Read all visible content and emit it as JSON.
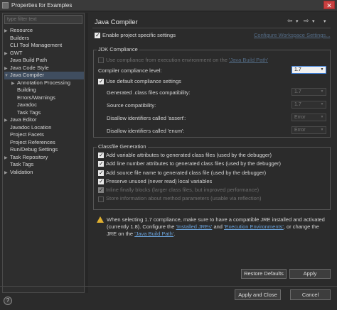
{
  "window": {
    "title": "Properties for Examples",
    "close_glyph": "✕"
  },
  "filter": {
    "placeholder": "type filter text"
  },
  "tree": [
    {
      "label": "Resource",
      "arrow": "▶",
      "indent": 0
    },
    {
      "label": "Builders",
      "arrow": "",
      "indent": 0
    },
    {
      "label": "CLI Tool Management",
      "arrow": "",
      "indent": 0
    },
    {
      "label": "GWT",
      "arrow": "▶",
      "indent": 0
    },
    {
      "label": "Java Build Path",
      "arrow": "",
      "indent": 0
    },
    {
      "label": "Java Code Style",
      "arrow": "▶",
      "indent": 0
    },
    {
      "label": "Java Compiler",
      "arrow": "▼",
      "indent": 0,
      "selected": true
    },
    {
      "label": "Annotation Processing",
      "arrow": "▶",
      "indent": 1
    },
    {
      "label": "Building",
      "arrow": "",
      "indent": 1
    },
    {
      "label": "Errors/Warnings",
      "arrow": "",
      "indent": 1
    },
    {
      "label": "Javadoc",
      "arrow": "",
      "indent": 1
    },
    {
      "label": "Task Tags",
      "arrow": "",
      "indent": 1
    },
    {
      "label": "Java Editor",
      "arrow": "▶",
      "indent": 0
    },
    {
      "label": "Javadoc Location",
      "arrow": "",
      "indent": 0
    },
    {
      "label": "Project Facets",
      "arrow": "",
      "indent": 0
    },
    {
      "label": "Project References",
      "arrow": "",
      "indent": 0
    },
    {
      "label": "Run/Debug Settings",
      "arrow": "",
      "indent": 0
    },
    {
      "label": "Task Repository",
      "arrow": "▶",
      "indent": 0
    },
    {
      "label": "Task Tags",
      "arrow": "",
      "indent": 0
    },
    {
      "label": "Validation",
      "arrow": "▶",
      "indent": 0
    }
  ],
  "page": {
    "title": "Java Compiler",
    "nav_back": "⇦",
    "nav_back_menu": "▾",
    "nav_forward": "⇨",
    "nav_forward_menu": "▾",
    "view_menu": "▾",
    "enable_specific": "Enable project specific settings",
    "configure_link": "Configure Workspace Settings...",
    "jdk": {
      "group_label": "JDK Compliance",
      "use_exec_env": "Use compliance from execution environment on the ",
      "use_exec_env_link": "'Java Build Path'",
      "compliance_level_label": "Compiler compliance level:",
      "compliance_level_value": "1.7",
      "use_default": "Use default compliance settings",
      "generated_label": "Generated .class files compatibility:",
      "generated_value": "1.7",
      "source_label": "Source compatibility:",
      "source_value": "1.7",
      "assert_label": "Disallow identifiers called 'assert':",
      "assert_value": "Error",
      "enum_label": "Disallow identifiers called 'enum':",
      "enum_value": "Error"
    },
    "classfile": {
      "group_label": "Classfile Generation",
      "items": [
        {
          "label": "Add variable attributes to generated class files (used by the debugger)",
          "checked": true,
          "disabled": false
        },
        {
          "label": "Add line number attributes to generated class files (used by the debugger)",
          "checked": true,
          "disabled": false
        },
        {
          "label": "Add source file name to generated class file (used by the debugger)",
          "checked": true,
          "disabled": false
        },
        {
          "label": "Preserve unused (never read) local variables",
          "checked": true,
          "disabled": false
        },
        {
          "label": "Inline finally blocks (larger class files, but improved performance)",
          "checked": true,
          "disabled": true
        },
        {
          "label": "Store information about method parameters (usable via reflection)",
          "checked": false,
          "disabled": true
        }
      ]
    },
    "warning": {
      "line1": "When selecting 1.7 compliance, make sure to have a compatible JRE installed and activated",
      "line2_pre": "(currently 1.8). Configure the ",
      "link_jres": "'Installed JREs'",
      "line2_mid": " and ",
      "link_envs": "'Execution Environments'",
      "line2_post": ", or change the",
      "line3_pre": "JRE on the ",
      "link_path": "'Java Build Path'",
      "line3_post": "."
    },
    "restore_defaults": "Restore Defaults",
    "apply": "Apply"
  },
  "footer": {
    "help": "?",
    "apply_and_close": "Apply and Close",
    "cancel": "Cancel"
  }
}
